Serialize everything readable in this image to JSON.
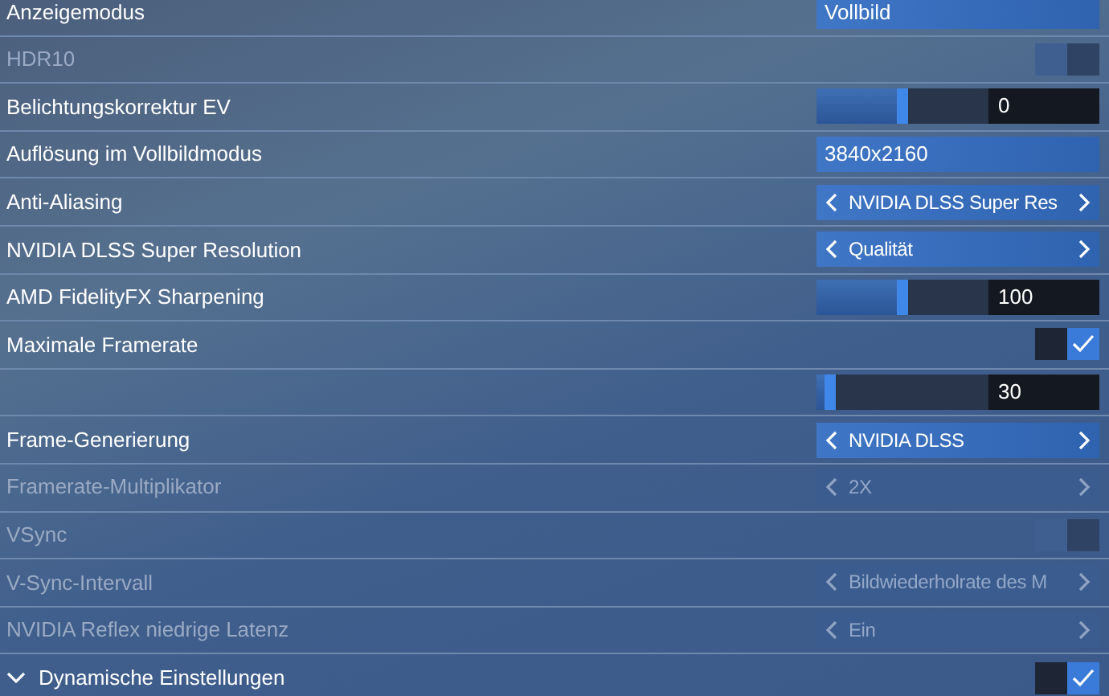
{
  "settings": [
    {
      "kind": "dropdown",
      "label": "Anzeigemodus",
      "disabled": false,
      "value": "Vollbild"
    },
    {
      "kind": "toggle",
      "label": "HDR10",
      "disabled": true,
      "checked": false
    },
    {
      "kind": "slider",
      "label": "Belichtungskorrektur EV",
      "disabled": false,
      "level": 0.5,
      "value": "0"
    },
    {
      "kind": "dropdown",
      "label": "Auflösung im Vollbildmodus",
      "disabled": false,
      "value": "3840x2160"
    },
    {
      "kind": "selector",
      "label": "Anti-Aliasing",
      "disabled": false,
      "value": "NVIDIA DLSS Super Res"
    },
    {
      "kind": "selector",
      "label": "NVIDIA DLSS Super Resolution",
      "disabled": false,
      "value": "Qualität"
    },
    {
      "kind": "slider",
      "label": "AMD FidelityFX Sharpening",
      "disabled": false,
      "level": 0.5,
      "value": "100"
    },
    {
      "kind": "toggle",
      "label": "Maximale Framerate",
      "disabled": false,
      "checked": true
    },
    {
      "kind": "slider",
      "disabled": false,
      "level": 0.05,
      "value": "30"
    },
    {
      "kind": "selector",
      "label": "Frame-Generierung",
      "disabled": false,
      "value": "NVIDIA DLSS"
    },
    {
      "kind": "selector",
      "label": "Framerate-Multiplikator",
      "disabled": true,
      "value": "2X"
    },
    {
      "kind": "toggle",
      "label": "VSync",
      "disabled": true,
      "checked": false
    },
    {
      "kind": "selector",
      "label": "V-Sync-Intervall",
      "disabled": true,
      "value": "Bildwiederholrate des M"
    },
    {
      "kind": "selector",
      "label": "NVIDIA Reflex niedrige Latenz",
      "disabled": true,
      "value": "Ein"
    },
    {
      "kind": "toggle",
      "label": "Dynamische Einstellungen",
      "disabled": false,
      "checked": true,
      "expanded": true
    }
  ]
}
